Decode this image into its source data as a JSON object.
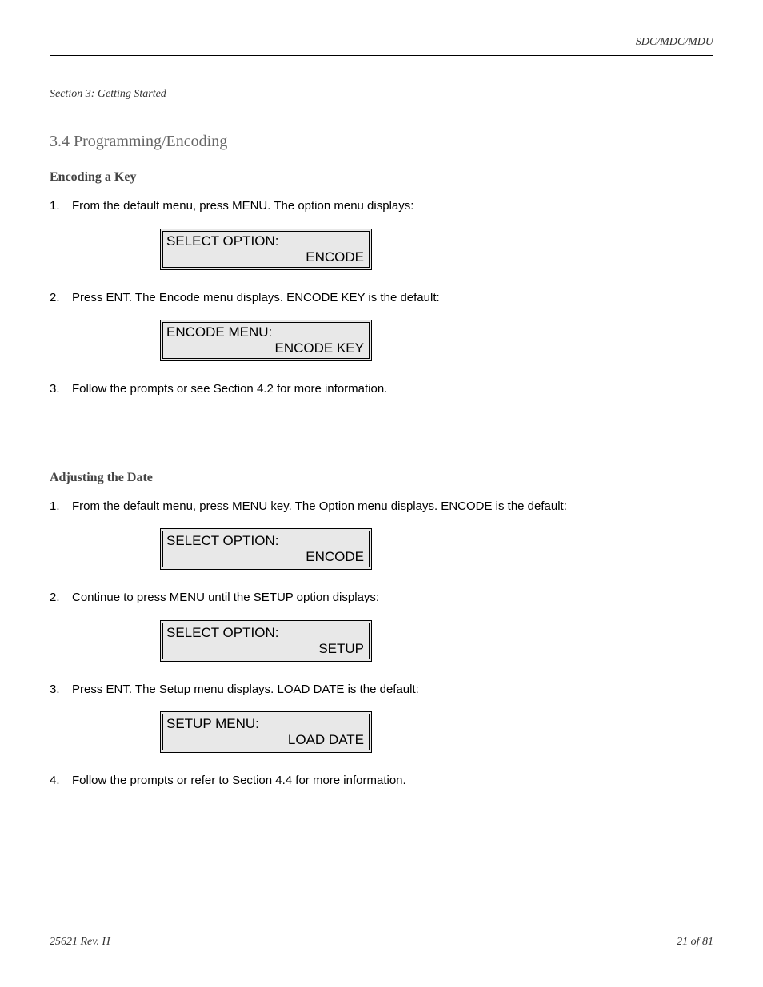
{
  "header": {
    "right": "SDC/MDC/MDU",
    "left": "Section 3: Getting Started"
  },
  "section_title": "3.4 Programming/Encoding",
  "encoding": {
    "title": "Encoding a Key",
    "steps": [
      {
        "num": "1.",
        "text": "From the default menu, press MENU. The option menu displays:"
      },
      {
        "num": "2.",
        "text": "Press ENT. The Encode menu displays. ENCODE KEY is the default:"
      },
      {
        "num": "3.",
        "text": "Follow the prompts or see Section 4.2 for more information."
      }
    ],
    "panels": [
      {
        "line1": "SELECT OPTION:",
        "line2": "ENCODE"
      },
      {
        "line1": "ENCODE MENU:",
        "line2": "ENCODE KEY"
      }
    ]
  },
  "date": {
    "title": "Adjusting the Date",
    "steps": [
      {
        "num": "1.",
        "text": "From the default menu, press MENU key. The Option menu displays. ENCODE is the default:"
      },
      {
        "num": "2.",
        "text": "Continue to press MENU until the SETUP option displays:"
      },
      {
        "num": "3.",
        "text": "Press ENT. The Setup menu displays. LOAD DATE is the default:"
      },
      {
        "num": "4.",
        "text": "Follow the prompts or refer to Section 4.4 for more information."
      }
    ],
    "panels": [
      {
        "line1": "SELECT OPTION:",
        "line2": "ENCODE"
      },
      {
        "line1": "SELECT OPTION:",
        "line2": "SETUP"
      },
      {
        "line1": "SETUP MENU:",
        "line2": "LOAD DATE"
      }
    ]
  },
  "footer": {
    "left": "25621 Rev. H",
    "right": "21 of 81"
  }
}
